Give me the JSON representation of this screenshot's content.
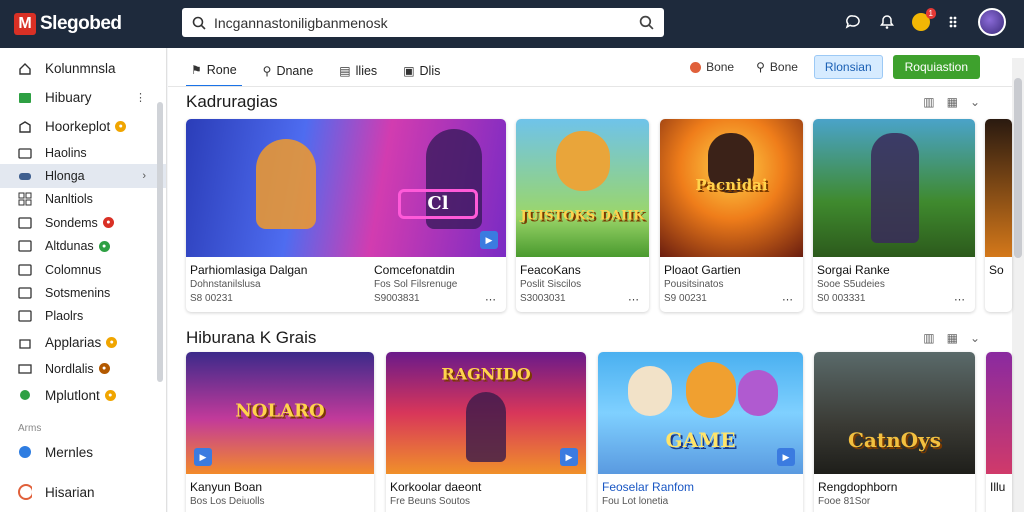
{
  "app": {
    "logo_letter": "M",
    "logo_text": "Slegobed"
  },
  "search": {
    "value": "Incgannastoniligbanmenosk"
  },
  "topbar": {
    "icons": [
      "chat-icon",
      "bell-icon",
      "coin-icon",
      "grid-icon",
      "avatar"
    ],
    "notif_count": "1"
  },
  "sidebar": {
    "items": [
      {
        "label": "Kolunmnsla",
        "icon": "home-icon"
      },
      {
        "label": "Hibuary",
        "icon": "library-icon"
      },
      {
        "label": "Hoorkeplot",
        "icon": "store-icon"
      },
      {
        "label": "Haolins",
        "icon": "folder-icon"
      },
      {
        "label": "Hlonga",
        "icon": "gamepad-icon"
      },
      {
        "label": "Nanltiols",
        "icon": "grid-icon"
      },
      {
        "label": "Sondems",
        "icon": "sound-icon"
      },
      {
        "label": "Altdunas",
        "icon": "album-icon"
      },
      {
        "label": "Colomnus",
        "icon": "columns-icon"
      },
      {
        "label": "Sotsmenins",
        "icon": "settings-icon"
      },
      {
        "label": "Plaolrs",
        "icon": "players-icon"
      },
      {
        "label": "Applarias",
        "icon": "apps-icon"
      },
      {
        "label": "Nordlalis",
        "icon": "mail-icon"
      },
      {
        "label": "Mplutlont",
        "icon": "plugin-icon"
      }
    ],
    "section_label": "Arms",
    "bottom_items": [
      {
        "label": "Mernles",
        "icon": "members-icon"
      },
      {
        "label": "Hisarian",
        "icon": "history-icon"
      }
    ]
  },
  "tabs": [
    {
      "label": "Rone",
      "icon": "flag-icon"
    },
    {
      "label": "Dnane",
      "icon": "user-icon"
    },
    {
      "label": "llies",
      "icon": "list-icon"
    },
    {
      "label": "Dlis",
      "icon": "briefcase-icon"
    }
  ],
  "actions": {
    "link1": "Bone",
    "link2": "Bone",
    "btn_outline": "Rlonsian",
    "btn_green": "Roquiastion"
  },
  "section1": {
    "title": "Kadruragias",
    "cards": [
      {
        "title": "Parhiomlasiga Dalgan",
        "sub": "Dohnstanilslusa",
        "meta": "S8 00231"
      },
      {
        "title": "Comcefonatdin",
        "sub": "Fos Sol Filsrenuge",
        "meta": "S9003831"
      },
      {
        "title": "FeacoKans",
        "sub": "Poslit Siscilos",
        "meta": "S3003031",
        "art": "JUISTOKS DAIIK"
      },
      {
        "title": "Ploaot Gartien",
        "sub": "Pousitsinatos",
        "meta": "S9 00231",
        "art": "Pacnidai"
      },
      {
        "title": "Sorgai Ranke",
        "sub": "Sooe S5udeies",
        "meta": "S0 003331"
      },
      {
        "title": "So",
        "sub": "",
        "meta": ""
      }
    ]
  },
  "section2": {
    "title": "Hiburana K Grais",
    "cards": [
      {
        "title": "Kanyun Boan",
        "sub": "Bos Los Deiuolls",
        "art": "NOLARO"
      },
      {
        "title": "Korkoolar daeont",
        "sub": "Fre Beuns Soutos",
        "art": "RAGNIDO"
      },
      {
        "title": "Feoselar Ranfom",
        "sub": "Fou Lot lonetia",
        "art": "GAME"
      },
      {
        "title": "Rengdophborn",
        "sub": "Fooe 81Sor",
        "art": "CatnOys"
      },
      {
        "title": "Illu",
        "sub": ""
      }
    ]
  },
  "colors": {
    "topbar": "#1e2a3c",
    "accent": "#1a73e8",
    "green": "#3ea12d"
  }
}
